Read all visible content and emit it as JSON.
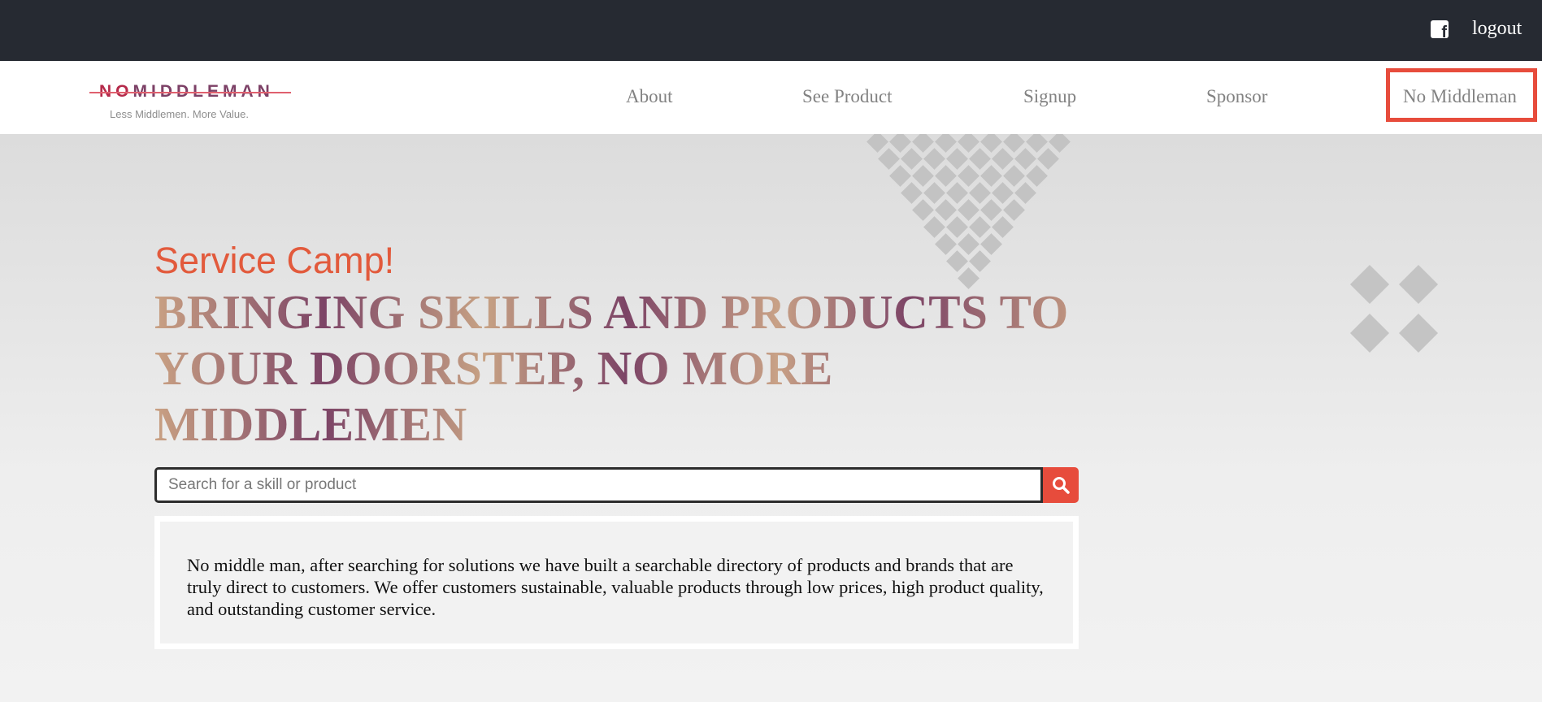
{
  "topbar": {
    "social_icon": "facebook-icon",
    "logout_label": "logout"
  },
  "logo": {
    "part_a": "NO",
    "part_b": "MIDDLEMAN",
    "tagline": "Less Middlemen. More Value."
  },
  "nav": {
    "items": [
      {
        "label": "About"
      },
      {
        "label": "See Product"
      },
      {
        "label": "Signup"
      },
      {
        "label": "Sponsor"
      },
      {
        "label": "No Middleman"
      }
    ]
  },
  "hero": {
    "subtitle": "Service Camp!",
    "headline": "BRINGING SKILLS AND PRODUCTS TO YOUR DOORSTEP, NO MORE MIDDLEMEN"
  },
  "search": {
    "placeholder": "Search for a skill or product",
    "button_icon": "search-icon"
  },
  "description": "No middle man, after searching for solutions we have built a searchable directory of products and brands that are truly direct to customers. We offer customers sustainable, valuable products through low prices, high product quality, and outstanding customer service.",
  "colors": {
    "topbar": "#262a32",
    "accent": "#e74c3c",
    "headline_gold": "#c9a183",
    "headline_plum": "#7c4466"
  }
}
